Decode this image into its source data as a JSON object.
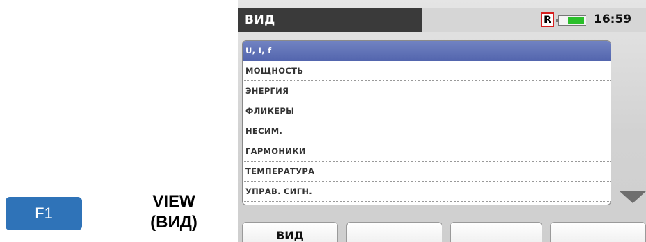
{
  "annotation": {
    "key_label": "F1",
    "caption_line1": "VIEW",
    "caption_line2": "(ВИД)"
  },
  "screen": {
    "title": "ВИД",
    "record_indicator": "R",
    "battery_level": 0.6,
    "clock": "16:59",
    "menu": {
      "selected_index": 0,
      "items": [
        "U, I, f",
        "МОЩНОСТЬ",
        "ЭНЕРГИЯ",
        "ФЛИКЕРЫ",
        "НЕСИМ.",
        "ГАРМОНИКИ",
        "ТЕМПЕРАТУРА",
        "УПРАВ. СИГН."
      ]
    },
    "softkeys": [
      "ВИД",
      "",
      "",
      ""
    ]
  },
  "colors": {
    "f1_key": "#2f73b8",
    "title_bar": "#3a3a3a",
    "selection": "#5466ae",
    "record_border": "#d62020",
    "battery_fill": "#2bbf2b"
  },
  "icons": {
    "scroll": "triangle-down-icon",
    "battery": "battery-icon"
  }
}
